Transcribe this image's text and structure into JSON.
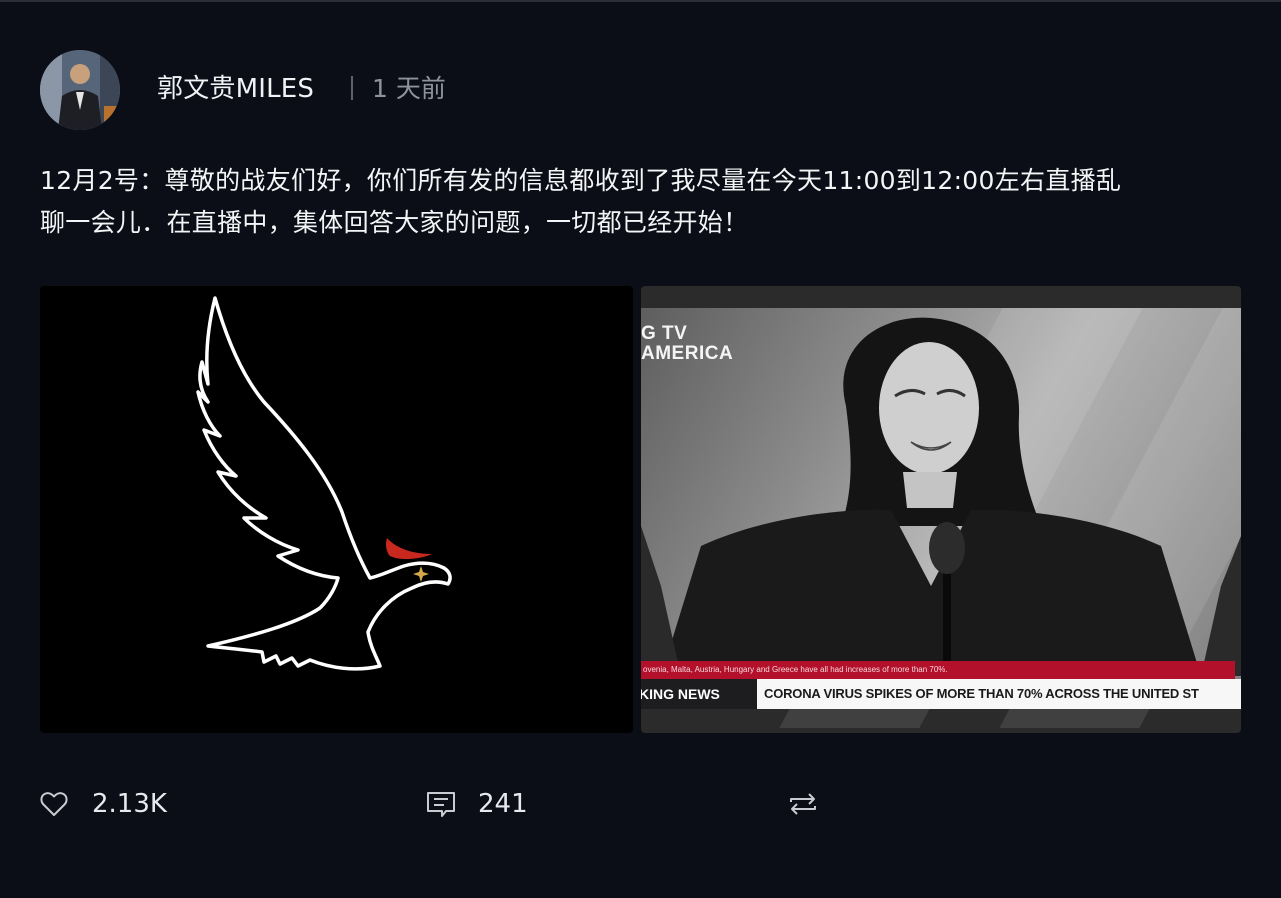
{
  "post": {
    "author": "郭文贵MILES",
    "time": "1 天前",
    "content_line1": "12月2号：尊敬的战友们好，你们所有发的信息都收到了我尽量在今天11:00到12:00左右直播乱",
    "content_line2": "聊一会儿．在直播中，集体回答大家的问题，一切都已经开始！",
    "likes": "2.13K",
    "comments": "241"
  },
  "image2": {
    "logo_line1": "G TV",
    "logo_line2": "AMERICA",
    "ticker_red": "ovenia, Malta, Austria, Hungary and Greece have all had increases of more than 70%.",
    "ticker_label": "KING NEWS",
    "ticker_headline": "CORONA VIRUS SPIKES OF MORE THAN 70% ACROSS THE UNITED ST"
  },
  "icons": {
    "like": "heart-outline-icon",
    "comment": "comment-icon",
    "repost": "repost-icon"
  },
  "colors": {
    "background": "#0b0e16",
    "eagle_accent": "#c8281e"
  }
}
